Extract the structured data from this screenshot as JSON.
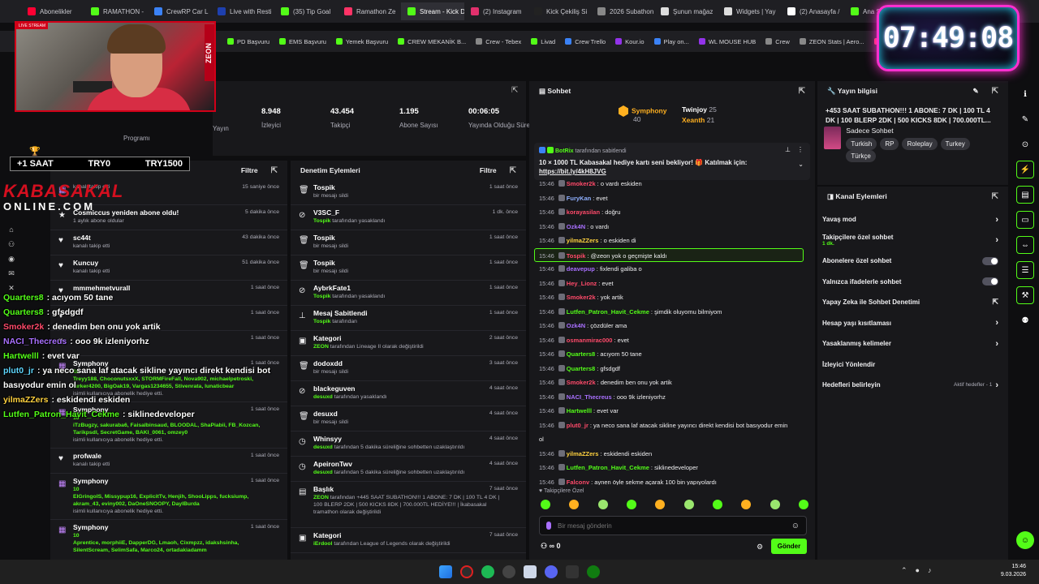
{
  "browser": {
    "tabs": [
      {
        "label": "Abonelikler",
        "color": "#ff0033"
      },
      {
        "label": "RAMATHON -",
        "color": "#53fc18"
      },
      {
        "label": "CrewRP Car L",
        "color": "#3b82f6"
      },
      {
        "label": "Live with Resti",
        "color": "#1e40af"
      },
      {
        "label": "(35) Tip Goal",
        "color": "#53fc18"
      },
      {
        "label": "Ramathon Ze",
        "color": "#ff3366"
      },
      {
        "label": "Stream - Kick Dashboard",
        "color": "#53fc18",
        "active": true
      },
      {
        "label": "(2) Instagram",
        "color": "#e1306c"
      },
      {
        "label": "Kick Çekiliş Si",
        "color": "#222222"
      },
      {
        "label": "2026 Subathon",
        "color": "#888888"
      },
      {
        "label": "Şunun mağaz",
        "color": "#dddddd"
      },
      {
        "label": "Widgets | Yay",
        "color": "#dddddd"
      },
      {
        "label": "(2) Anasayfa /",
        "color": "#ffffff"
      },
      {
        "label": "Ana Sayfa",
        "color": "#53fc18"
      },
      {
        "label": "Toy Building S",
        "color": "#ff3366"
      }
    ],
    "bookmarks": [
      {
        "label": "PD Başvuru",
        "color": "#53fc18"
      },
      {
        "label": "EMS Başvuru",
        "color": "#53fc18"
      },
      {
        "label": "Yemek Başvuru",
        "color": "#53fc18"
      },
      {
        "label": "CREW MEKANİK B...",
        "color": "#53fc18"
      },
      {
        "label": "Crew - Tebex",
        "color": "#888888"
      },
      {
        "label": "Livad",
        "color": "#53fc18"
      },
      {
        "label": "Crew Trello",
        "color": "#3b82f6"
      },
      {
        "label": "Kour.io",
        "color": "#9333ea"
      },
      {
        "label": "Play on...",
        "color": "#3b82f6"
      },
      {
        "label": "WL MOUSE HUB",
        "color": "#9333ea"
      },
      {
        "label": "Crew",
        "color": "#888888"
      },
      {
        "label": "ZEON Stats | Aero...",
        "color": "#888888"
      },
      {
        "label": "APIq",
        "color": "#ff3366"
      }
    ]
  },
  "overlay": {
    "clock": "07:49:08",
    "live_label": "LIVE STREAM",
    "cam_brand": "ZEON",
    "subgoal": {
      "left": "+1 SAAT",
      "mid": "TRY0",
      "right": "TRY1500"
    },
    "logo_line1": "KABASAKAL",
    "logo_line2": "ONLINE.COM",
    "chat": [
      {
        "name": "Quarters8",
        "text": "acıyom 50 tane",
        "color": "#53fc18"
      },
      {
        "name": "Quarters8",
        "text": "gfsdgdf",
        "color": "#53fc18"
      },
      {
        "name": "Smoker2k",
        "text": "denedim ben onu yok artik",
        "color": "#ff4a6a"
      },
      {
        "name": "NACI_Thecreus",
        "text": "ooo 9k izleniyorhz",
        "color": "#a970ff"
      },
      {
        "name": "Hartwelll",
        "text": "evet var",
        "color": "#53fc18"
      },
      {
        "name": "plut0_jr",
        "text": "ya neco sana laf atacak sikline yayıncı direkt kendisi bot basıyodur emin ol",
        "color": "#5fd7ff"
      },
      {
        "name": "yilmaZZers",
        "text": "eskidendi eskiden",
        "color": "#ffd23f"
      },
      {
        "name": "Lutfen_Patron_Havit_Cekme",
        "text": "siklinedeveloper",
        "color": "#53fc18"
      }
    ]
  },
  "stats": [
    {
      "value": "8.948",
      "label": "İzleyici"
    },
    {
      "value": "43.454",
      "label": "Takipçi"
    },
    {
      "value": "1.195",
      "label": "Abone Sayısı"
    },
    {
      "value": "00:06:05",
      "label": "Yayında Olduğu Süre"
    }
  ],
  "stats_extra": {
    "yayin": "Yayın",
    "programi": "Programı"
  },
  "activity": {
    "filter": "Filtre",
    "rows": [
      {
        "icon": "gift",
        "title": "",
        "sub": "kanalı takip etti",
        "time": "15 saniye önce"
      },
      {
        "icon": "star",
        "title": "Cosmiccus yeniden abone oldu!",
        "sub": "1 aylık abone oldular",
        "time": "5 dakika önce"
      },
      {
        "icon": "heart",
        "title": "sc44t",
        "sub": "kanalı takip etti",
        "time": "43 dakika önce"
      },
      {
        "icon": "heart",
        "title": "Kuncuy",
        "sub": "kanalı takip etti",
        "time": "51 dakika önce"
      },
      {
        "icon": "heart",
        "title": "mmmehmetvurall",
        "sub": "",
        "time": "1 saat önce"
      },
      {
        "icon": "heart",
        "title": "",
        "sub": "",
        "time": "1 saat önce"
      },
      {
        "icon": "heart",
        "title": "",
        "sub": "",
        "time": "1 saat önce"
      },
      {
        "icon": "gift",
        "title": "Symphony",
        "sub": "isimli kullanıcıya abonelik hediye etti.",
        "time": "1 saat önce",
        "count": "10",
        "names": "Treyy188, ChoconutsxxX, STORMFireFall, Nova902, michaelpetroski, lurker4200, BigOak19, Vargas1234655, Stivenrata, lunaticbear",
        "tall": true
      },
      {
        "icon": "gift",
        "title": "Symphony",
        "sub": "isimli kullanıcıya abonelik hediye etti.",
        "time": "1 saat önce",
        "count": "10",
        "names": "iTzBugzy, sakuraba6, Faisalbinsaud, BLOODAL, ShaPiabii, FB_Kozcan, Tarikpsdl, SecretGame, BAKI_0061, omzey0",
        "tall": true
      },
      {
        "icon": "heart",
        "title": "profwale",
        "sub": "kanalı takip etti",
        "time": "1 saat önce"
      },
      {
        "icon": "gift",
        "title": "Symphony",
        "sub": "isimli kullanıcıya abonelik hediye etti.",
        "time": "1 saat önce",
        "count": "10",
        "names": "ElGringoIS, Missypup16, ExplicitTv, Henjih, ShooLipps, fucksiump, akram_43, eviny002, DaOneSNOOPY, DaylBurda",
        "tall": true
      },
      {
        "icon": "gift",
        "title": "Symphony",
        "sub": "",
        "time": "1 saat önce",
        "count": "10",
        "names": "Aprentice, morphiiE, DapperDG, Lmaoh, Cixmpzz, idakshsinha, SilentScream, SelimSafa, Marco24, ortadakiadamm",
        "tall": true
      }
    ]
  },
  "moderation": {
    "title": "Denetim Eylemleri",
    "filter": "Filtre",
    "rows": [
      {
        "icon": "trash",
        "title": "Tospik",
        "sub": "bir mesajı sildi",
        "by": "",
        "time": "1 saat önce"
      },
      {
        "icon": "ban",
        "title": "V3SC_F",
        "by": "Tospik",
        "sub": "tarafından yasaklandı",
        "time": "1 dk. önce"
      },
      {
        "icon": "trash",
        "title": "Tospik",
        "sub": "bir mesajı sildi",
        "by": "",
        "time": "1 saat önce"
      },
      {
        "icon": "trash",
        "title": "Tospik",
        "sub": "bir mesajı sildi",
        "by": "",
        "time": "1 saat önce"
      },
      {
        "icon": "ban",
        "title": "AybrkFate1",
        "by": "Tospik",
        "sub": "tarafından yasaklandı",
        "time": "1 saat önce"
      },
      {
        "icon": "pin",
        "title": "Mesaj Sabitlendi",
        "by": "Tospik",
        "sub": "tarafından",
        "time": "1 saat önce"
      },
      {
        "icon": "category",
        "title": "Kategori",
        "by": "ZEON",
        "sub": "tarafından Lineage II olarak değiştirildi",
        "time": "2 saat önce"
      },
      {
        "icon": "trash",
        "title": "dodoxdd",
        "sub": "bir mesajı sildi",
        "by": "",
        "time": "3 saat önce"
      },
      {
        "icon": "ban",
        "title": "blackeguven",
        "by": "desuxd",
        "sub": "tarafından yasaklandı",
        "time": "4 saat önce"
      },
      {
        "icon": "trash",
        "title": "desuxd",
        "sub": "bir mesajı sildi",
        "by": "",
        "time": "4 saat önce"
      },
      {
        "icon": "timeout",
        "title": "Whinsyy",
        "by": "desuxd",
        "sub": "tarafından 5 dakika süreliğine sohbetten uzaklaştırıldı",
        "time": "4 saat önce"
      },
      {
        "icon": "timeout",
        "title": "ApeironTwv",
        "by": "desuxd",
        "sub": "tarafından 5 dakika süreliğine sohbetten uzaklaştırıldı",
        "time": "4 saat önce"
      },
      {
        "icon": "title",
        "title": "Başlık",
        "by": "ZEON",
        "sub": "tarafından +445 SAAT SUBATHON!!! 1 ABONE: 7 DK | 100 TL 4 DK | 100 BLERP 2DK | 500 KICKS 8DK | 700.000TL HEDİYE!!! | İkabasakal tramathon olarak değiştirildi",
        "time": "7 saat önce",
        "tall": true
      },
      {
        "icon": "category",
        "title": "Kategori",
        "by": "iErdool",
        "sub": "tarafından League of Legends olarak değiştirildi",
        "time": "7 saat önce"
      }
    ]
  },
  "chat": {
    "title": "Sohbet",
    "leaders": [
      {
        "name": "Symphony",
        "score": "40",
        "color": "#ffb020"
      },
      {
        "name": "Twinjoy",
        "score": "25",
        "color": "#ffffff"
      },
      {
        "name": "Xeanth",
        "score": "21",
        "color": "#ffb020"
      }
    ],
    "pinned": {
      "by": "BotRix",
      "by_suffix": "tarafından sabitlendi",
      "text": "10 × 1000 TL Kabasakal hediye kartı seni bekliyor! 🎁 Katılmak için:",
      "link": "https://bit.ly/4kH8JVG"
    },
    "messages": [
      {
        "time": "15:46",
        "name": "Smoker2k",
        "text": "o vardı eskiden",
        "color": "#ff4a6a"
      },
      {
        "time": "15:46",
        "name": "FuryKan",
        "text": "evet",
        "color": "#8fb0ff"
      },
      {
        "time": "15:46",
        "name": "korayasilan",
        "text": "doğru",
        "color": "#ff4a6a"
      },
      {
        "time": "15:46",
        "name": "Ozk4N",
        "text": "o vardı",
        "color": "#a970ff"
      },
      {
        "time": "15:46",
        "name": "yilmaZZers",
        "text": "o eskiden di",
        "color": "#ffd23f"
      },
      {
        "time": "15:46",
        "name": "Tospik",
        "text": "@zeon yok o geçmişte kaldı",
        "color": "#ff4a6a",
        "hl": true
      },
      {
        "time": "15:46",
        "name": "deavepup",
        "text": "fixlendi galiba o",
        "color": "#a970ff"
      },
      {
        "time": "15:46",
        "name": "Hey_Lionz",
        "text": "evet",
        "color": "#ff4a6a"
      },
      {
        "time": "15:46",
        "name": "Smoker2k",
        "text": "yok artik",
        "color": "#ff4a6a"
      },
      {
        "time": "15:46",
        "name": "Lutfen_Patron_Havit_Cekme",
        "text": "şimdik oluyomu bilmiyom",
        "color": "#53fc18"
      },
      {
        "time": "15:46",
        "name": "Ozk4N",
        "text": "çözdüler ama",
        "color": "#a970ff"
      },
      {
        "time": "15:46",
        "name": "osmanmirac000",
        "text": "evet",
        "color": "#ff4a6a"
      },
      {
        "time": "15:46",
        "name": "Quarters8",
        "text": "acıyom 50 tane",
        "color": "#53fc18"
      },
      {
        "time": "15:46",
        "name": "Quarters8",
        "text": "gfsdgdf",
        "color": "#53fc18"
      },
      {
        "time": "15:46",
        "name": "Smoker2k",
        "text": "denedim ben onu yok artik",
        "color": "#ff4a6a"
      },
      {
        "time": "15:46",
        "name": "NACI_Thecreus",
        "text": "ooo 9k izleniyorhz",
        "color": "#a970ff"
      },
      {
        "time": "15:46",
        "name": "Hartwelll",
        "text": "evet var",
        "color": "#53fc18"
      },
      {
        "time": "15:46",
        "name": "plut0_jr",
        "text": "ya neco sana laf atacak sikline yayıncı direkt kendisi bot basıyodur emin",
        "color": "#ff4a6a",
        "cont": "ol"
      },
      {
        "time": "15:46",
        "name": "yilmaZZers",
        "text": "eskidendi eskiden",
        "color": "#ffd23f"
      },
      {
        "time": "15:46",
        "name": "Lutfen_Patron_Havit_Cekme",
        "text": "siklinedeveloper",
        "color": "#53fc18"
      },
      {
        "time": "15:46",
        "name": "Falconv",
        "text": "aynen öyle sekme açarak 100 bin yapıyolardı",
        "color": "#ff4a6a"
      }
    ],
    "followers_only": "Takipçilere Özel",
    "placeholder": "Bir mesaj gönderin",
    "points": "0",
    "send": "Gönder"
  },
  "info": {
    "title": "Yayın bilgisi",
    "stream_title": "+453 SAAT SUBATHON!!! 1 ABONE: 7 DK | 100 TL 4 DK | 100 BLERP 2DK | 500 KICKS 8DK | 700.000TL...",
    "category": "Sadece Sohbet",
    "tags": [
      "Turkish",
      "RP",
      "Roleplay",
      "Turkey",
      "Türkçe"
    ]
  },
  "actions": {
    "title": "Kanal Eylemleri",
    "items": [
      {
        "label": "Yavaş mod",
        "ctrl": "chev"
      },
      {
        "label": "Takipçilere özel sohbet",
        "sub": "1 dk.",
        "ctrl": "chev"
      },
      {
        "label": "Abonelere özel sohbet",
        "ctrl": "tog"
      },
      {
        "label": "Yalnızca ifadelerle sohbet",
        "ctrl": "tog"
      },
      {
        "label": "Yapay Zeka ile Sohbet Denetimi",
        "ctrl": "ext"
      },
      {
        "label": "Hesap yaşı kısıtlaması",
        "ctrl": "chev"
      },
      {
        "label": "Yasaklanmış kelimeler",
        "ctrl": "chev"
      },
      {
        "label": "İzleyici Yönlendir",
        "ctrl": ""
      },
      {
        "label": "Hedefleri belirleyin",
        "ctrl": "chev",
        "extra": "Aktif hedefler - 1"
      }
    ]
  },
  "tray": {
    "time": "15:46",
    "date": "9.03.2026"
  }
}
